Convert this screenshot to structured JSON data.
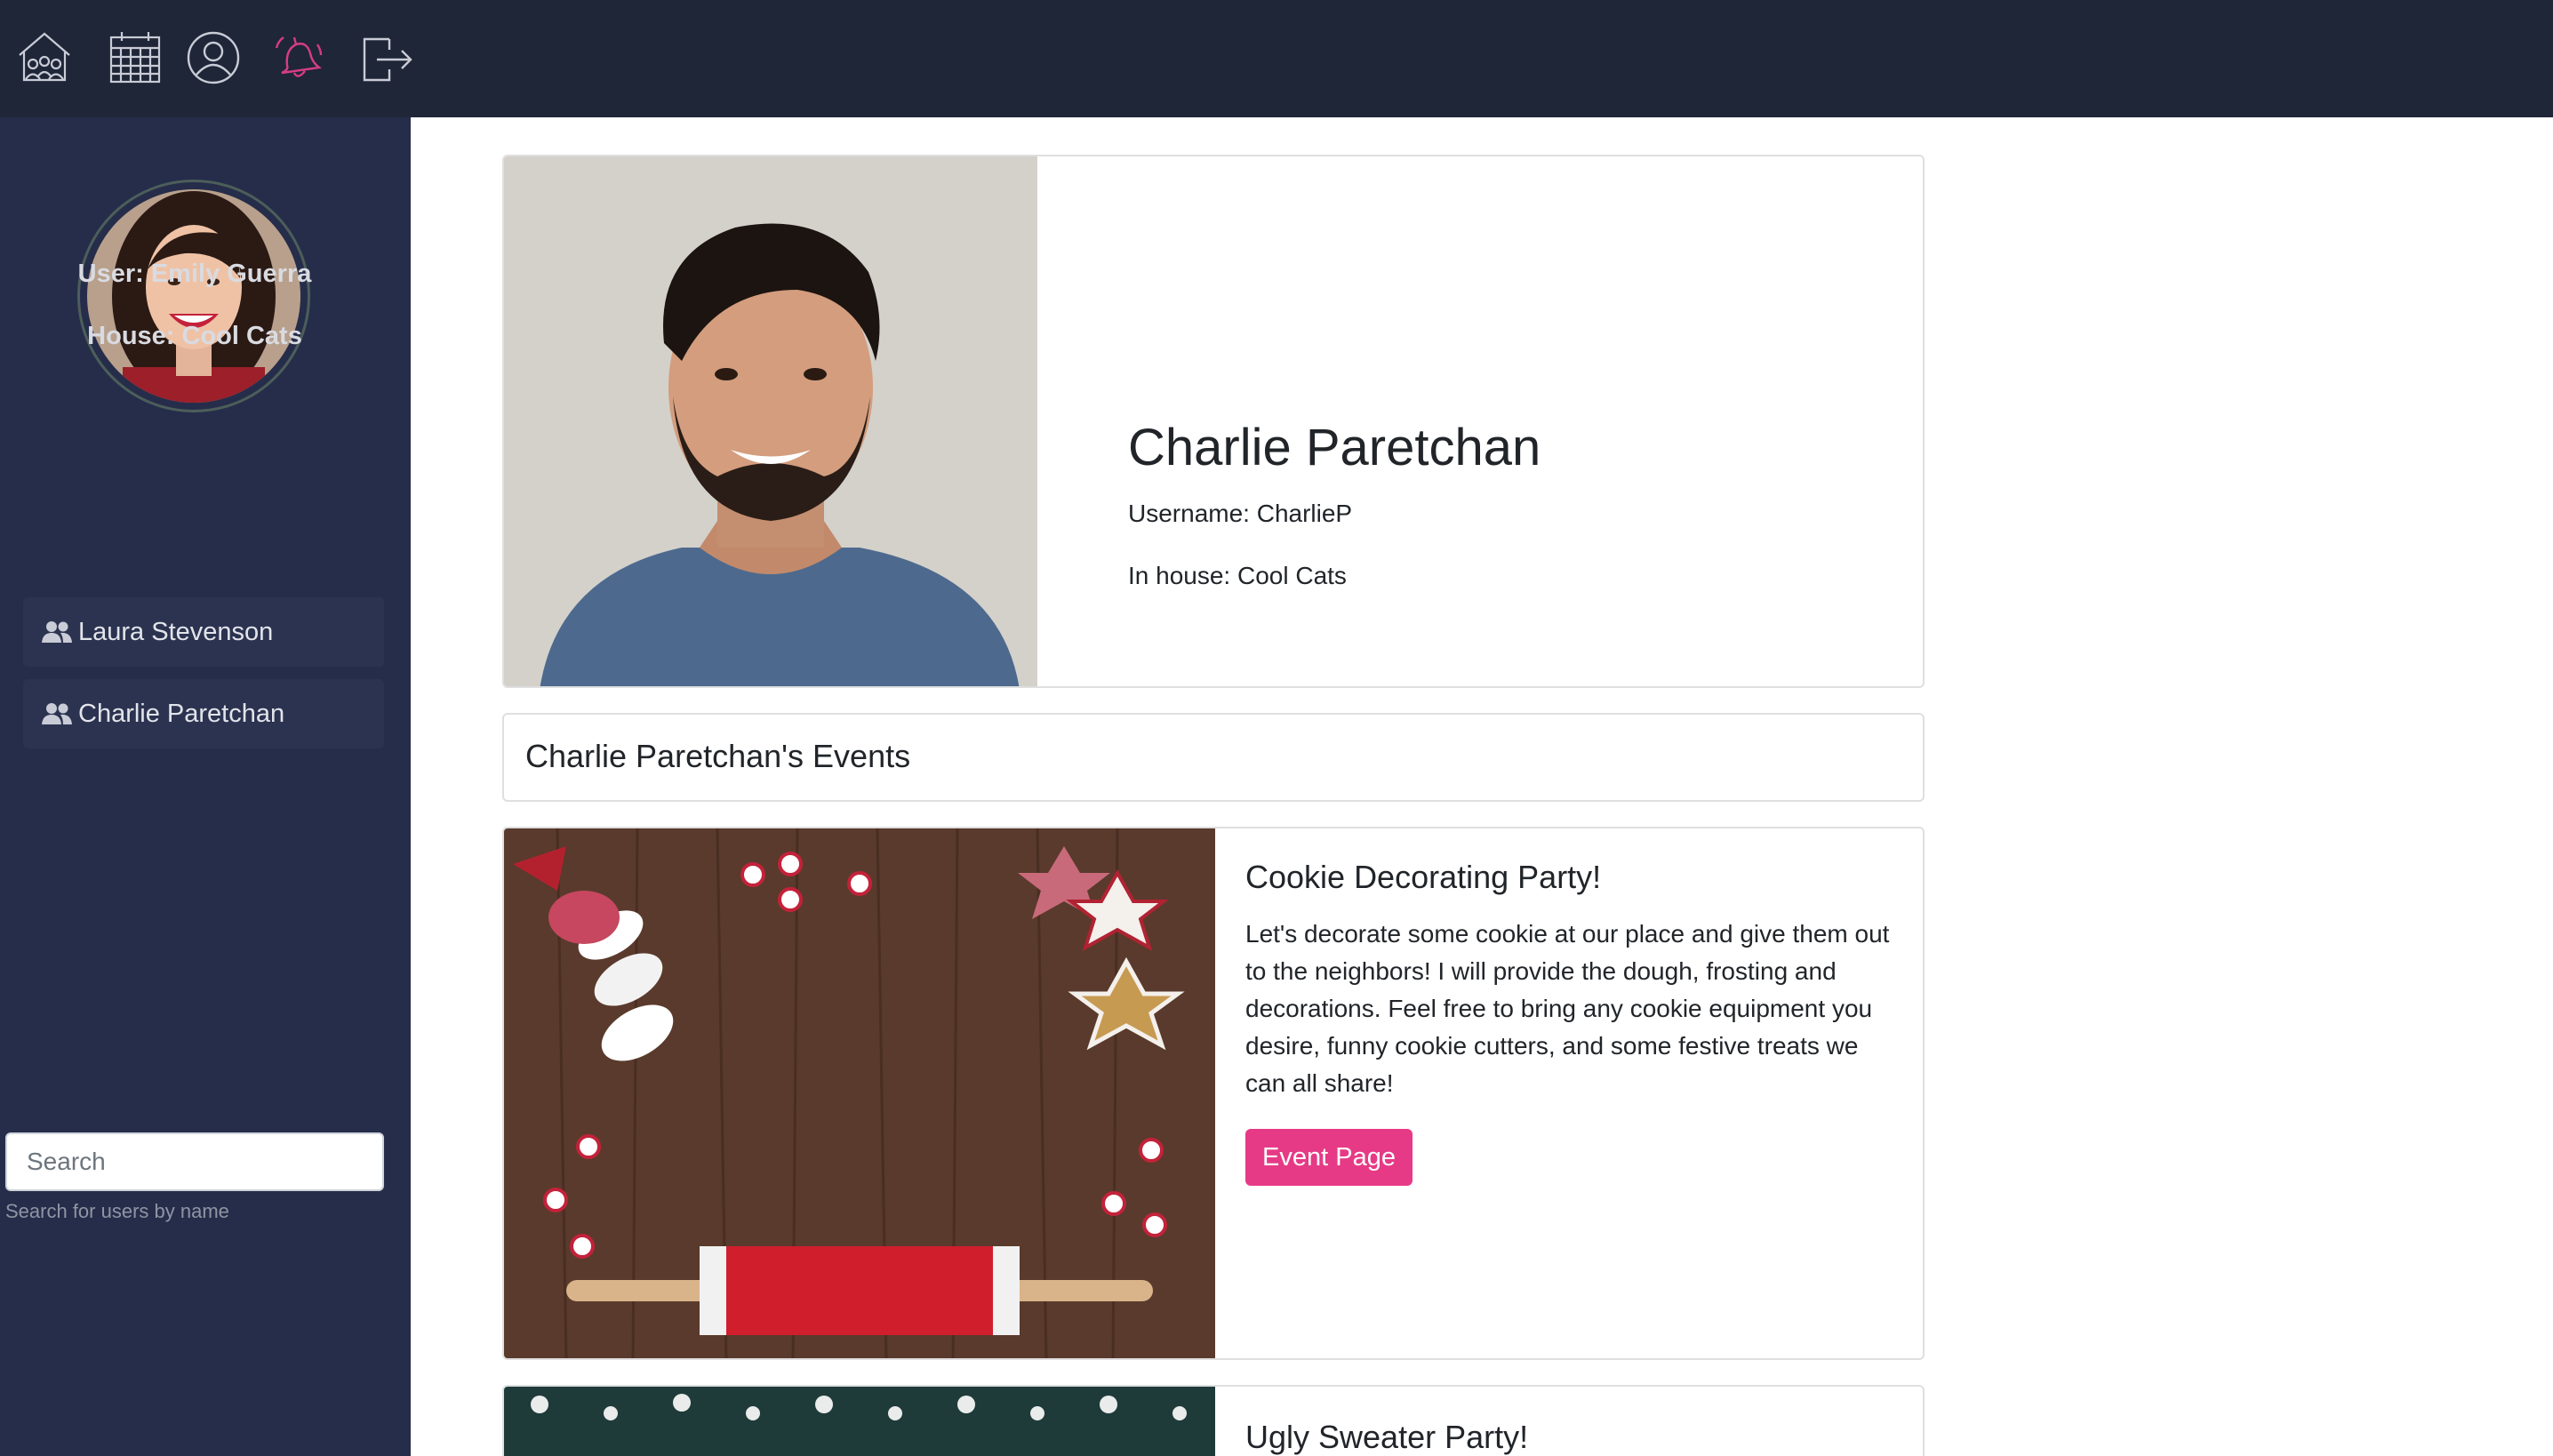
{
  "nav": {
    "icons": [
      "home-group-icon",
      "calendar-icon",
      "user-circle-icon",
      "bell-icon",
      "logout-icon"
    ],
    "bell_color": "#d63d83",
    "icon_color": "#c9ccd6"
  },
  "sidebar": {
    "user_line": "User: Emily Guerra",
    "house_line": "House: Cool Cats",
    "members": [
      {
        "name": "Laura Stevenson"
      },
      {
        "name": "Charlie Paretchan"
      }
    ],
    "search_placeholder": "Search",
    "search_help": "Search for users by name"
  },
  "profile": {
    "name": "Charlie Paretchan",
    "username": "Username: CharlieP",
    "house": "In house: Cool Cats"
  },
  "events": {
    "header": "Charlie Paretchan's Events",
    "items": [
      {
        "title": "Cookie Decorating Party!",
        "description": "Let's decorate some cookie at our place and give them out to the neighbors! I will provide the dough, frosting and decorations. Feel free to bring any cookie equipment you desire, funny cookie cutters, and some festive treats we can all share!",
        "button": "Event Page"
      },
      {
        "title": "Ugly Sweater Party!"
      }
    ]
  },
  "colors": {
    "topbar": "#1f2638",
    "sidebar": "#262d4a",
    "accent": "#e63a86"
  }
}
